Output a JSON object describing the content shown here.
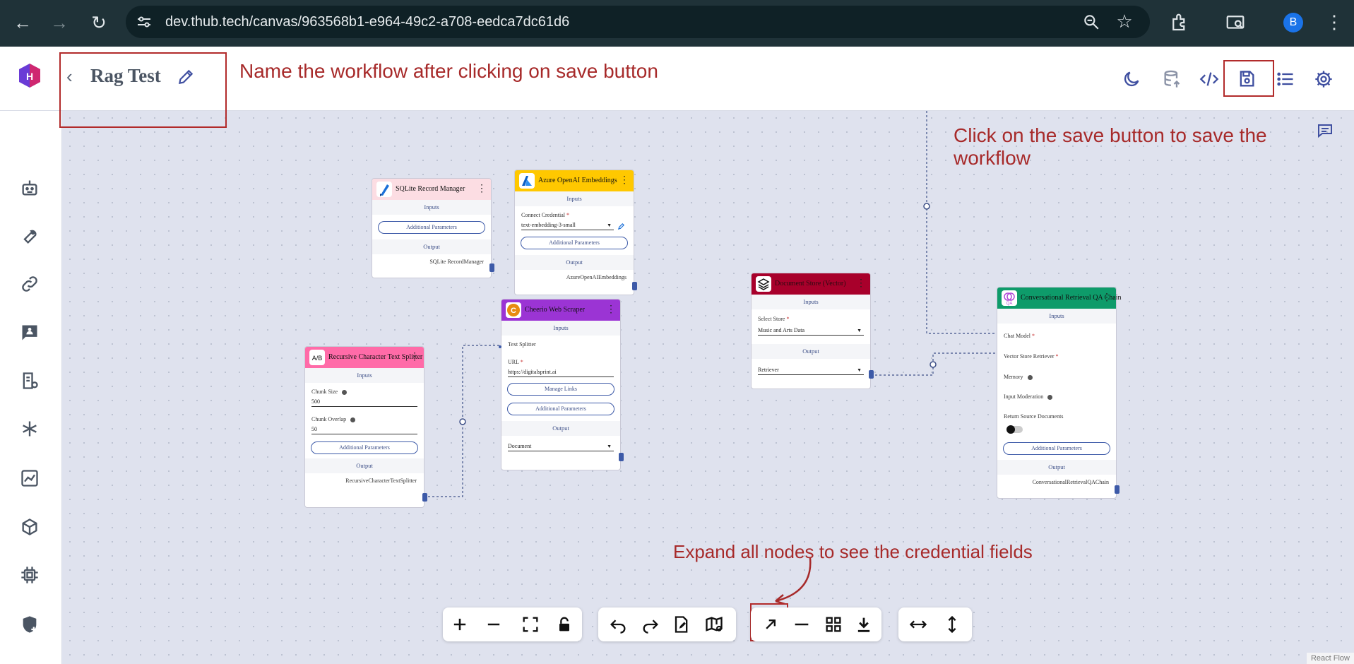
{
  "browser": {
    "url": "dev.thub.tech/canvas/963568b1-e964-49c2-a708-eedca7dc61d6",
    "profile_initial": "B"
  },
  "header": {
    "title": "Rag Test",
    "icons": [
      "moon-icon",
      "database-upload-icon",
      "code-icon",
      "save-icon",
      "list-icon",
      "gear-icon"
    ]
  },
  "sidebar": {
    "icons": [
      "robot-icon",
      "tools-icon",
      "link-icon",
      "chat-icon",
      "document-store-icon",
      "sparkle-icon",
      "analytics-icon",
      "cube-icon",
      "chip-icon",
      "shield-icon"
    ]
  },
  "annotations": {
    "name_workflow": "Name the workflow after clicking on save button",
    "save_workflow": "Click on the save button to save the workflow",
    "expand_nodes": "Expand all nodes to see the credential fields"
  },
  "nodes": {
    "sqlite": {
      "title": "SQLite Record Manager",
      "inputs": "Inputs",
      "additional": "Additional Parameters",
      "output": "Output",
      "output_label": "SQLite RecordManager"
    },
    "azure": {
      "title": "Azure OpenAI Embeddings",
      "inputs": "Inputs",
      "credential_label": "Connect Credential",
      "credential_value": "text-embedding-3-small",
      "additional": "Additional Parameters",
      "output": "Output",
      "output_label": "AzureOpenAIEmbeddings"
    },
    "cheerio": {
      "title": "Cheerio Web Scraper",
      "inputs": "Inputs",
      "text_splitter": "Text Splitter",
      "url_label": "URL",
      "url_value": "https://digitalsprint.ai",
      "manage_links": "Manage Links",
      "additional": "Additional Parameters",
      "output": "Output",
      "output_value": "Document"
    },
    "splitter": {
      "title": "Recursive Character Text Splitter",
      "inputs": "Inputs",
      "chunk_size_label": "Chunk Size",
      "chunk_size": "500",
      "chunk_overlap_label": "Chunk Overlap",
      "chunk_overlap": "50",
      "additional": "Additional Parameters",
      "output": "Output",
      "output_label": "RecursiveCharacterTextSplitter"
    },
    "docstore": {
      "title": "Document Store (Vector)",
      "inputs": "Inputs",
      "select_store_label": "Select Store",
      "select_store_value": "Music and Arts Data",
      "output": "Output",
      "output_value": "Retriever"
    },
    "qa_chain": {
      "title": "Conversational Retrieval QA Chain",
      "inputs": "Inputs",
      "chat_model": "Chat Model",
      "vector_store_retriever": "Vector Store Retriever",
      "memory": "Memory",
      "input_moderation": "Input Moderation",
      "return_source": "Return Source Documents",
      "additional": "Additional Parameters",
      "output": "Output",
      "output_label": "ConversationalRetrievalQAChain"
    }
  },
  "toolbar": {
    "icons": [
      "zoom-in-icon",
      "zoom-out-icon",
      "fit-view-icon",
      "lock-icon",
      "undo-icon",
      "redo-icon",
      "edit-note-icon",
      "minimap-icon",
      "expand-nodes-icon",
      "collapse-nodes-icon",
      "grid-icon",
      "download-icon",
      "horizontal-layout-icon",
      "vertical-layout-icon"
    ]
  },
  "footer": {
    "react_flow": "React Flow"
  },
  "colors": {
    "annotation": "#a72a2a",
    "sqlite_header": "#fcdde3",
    "azure_header": "#ffc800",
    "cheerio_header": "#9b34d4",
    "splitter_header": "#ff6ba8",
    "docstore_header": "#a8002b",
    "qa_header": "#0e9b6a",
    "handle": "#3d5aa8"
  }
}
